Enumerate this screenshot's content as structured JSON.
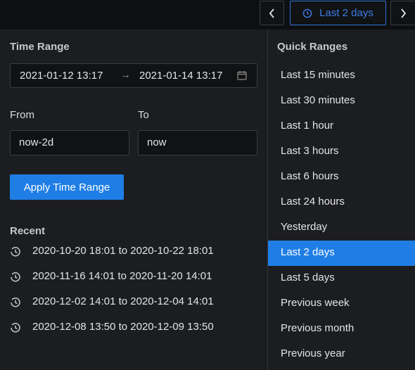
{
  "topbar": {
    "prev_icon": "chevron-left-icon",
    "next_icon": "chevron-right-icon",
    "trigger_icon": "clock-icon",
    "trigger_label": "Last 2 days"
  },
  "time_range": {
    "title": "Time Range",
    "start": "2021-01-12 13:17",
    "arrow": "→",
    "end": "2021-01-14 13:17",
    "calendar_icon": "calendar-icon"
  },
  "from": {
    "label": "From",
    "value": "now-2d"
  },
  "to": {
    "label": "To",
    "value": "now"
  },
  "apply_label": "Apply Time Range",
  "recent": {
    "title": "Recent",
    "icon": "history-icon",
    "items": [
      "2020-10-20 18:01 to 2020-10-22 18:01",
      "2020-11-16 14:01 to 2020-11-20 14:01",
      "2020-12-02 14:01 to 2020-12-04 14:01",
      "2020-12-08 13:50 to 2020-12-09 13:50"
    ]
  },
  "quick_ranges": {
    "title": "Quick Ranges",
    "selected": "Last 2 days",
    "items": [
      "Last 15 minutes",
      "Last 30 minutes",
      "Last 1 hour",
      "Last 3 hours",
      "Last 6 hours",
      "Last 24 hours",
      "Yesterday",
      "Last 2 days",
      "Last 5 days",
      "Previous week",
      "Previous month",
      "Previous year"
    ]
  },
  "colors": {
    "accent": "#1f7ee6",
    "background": "#1c1d20",
    "input_background": "#111214",
    "border": "#3a3c40"
  }
}
